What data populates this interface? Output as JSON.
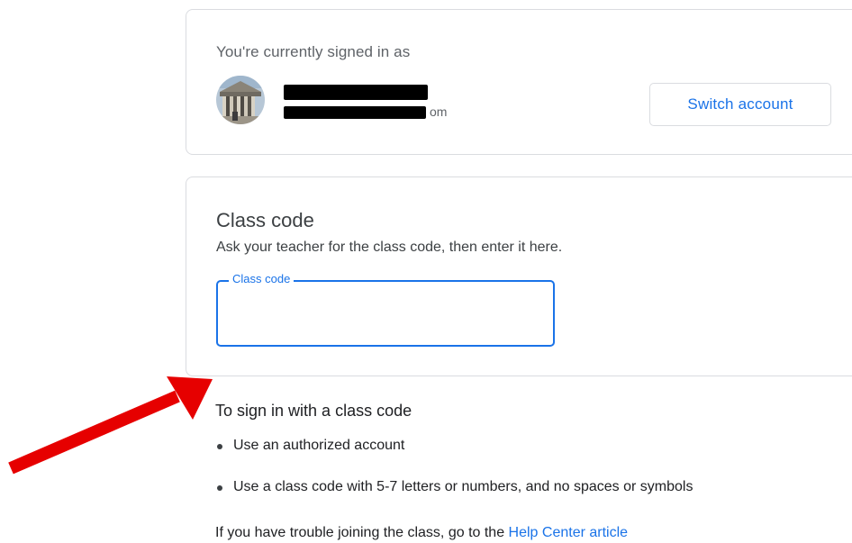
{
  "account": {
    "signed_in_label": "You're currently signed in as",
    "user_name": "",
    "user_email_suffix": "om",
    "switch_button_label": "Switch account"
  },
  "class_code": {
    "title": "Class code",
    "description": "Ask your teacher for the class code, then enter it here.",
    "field_label": "Class code",
    "field_value": ""
  },
  "instructions": {
    "title": "To sign in with a class code",
    "items": [
      "Use an authorized account",
      "Use a class code with 5-7 letters or numbers, and no spaces or symbols"
    ],
    "help_text": "If you have trouble joining the class, go to the ",
    "help_link": "Help Center article"
  },
  "annotation": {
    "arrow_color": "#e60000"
  },
  "colors": {
    "accent": "#1a73e8",
    "border": "#dadce0"
  }
}
